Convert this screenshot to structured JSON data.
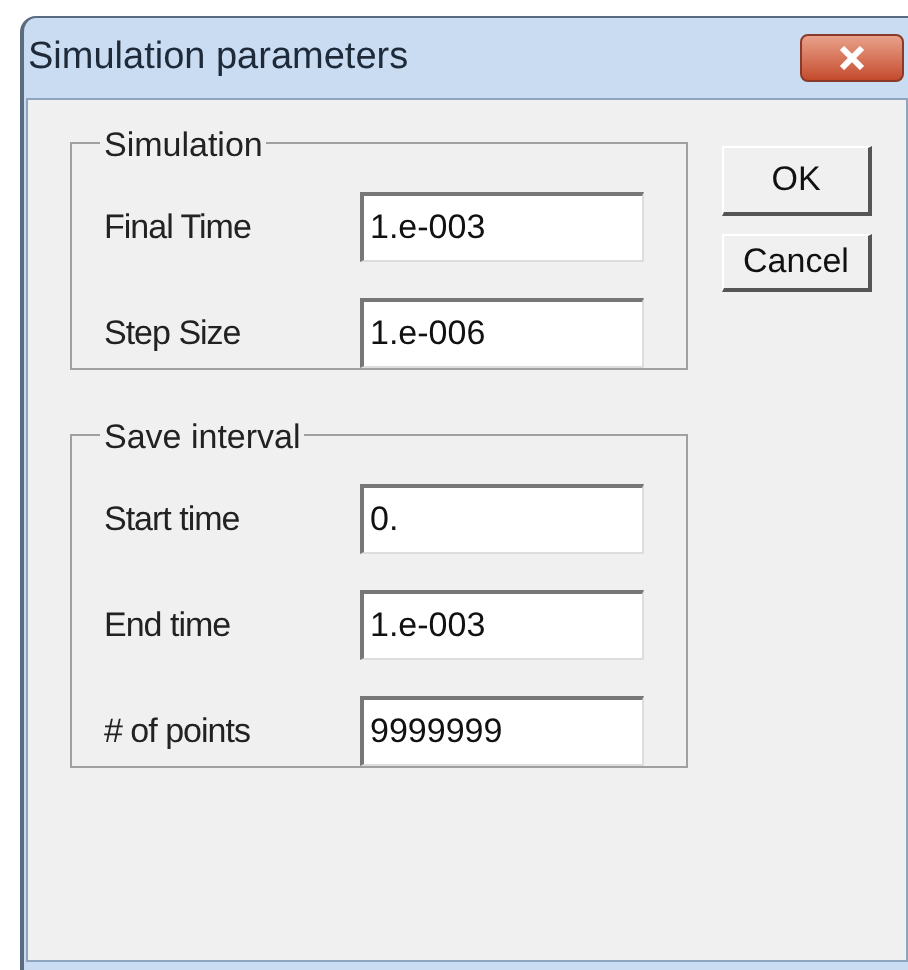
{
  "window": {
    "title": "Simulation parameters"
  },
  "groups": [
    {
      "title": "Simulation",
      "fields": [
        {
          "label": "Final Time",
          "value": "1.e-003"
        },
        {
          "label": "Step Size",
          "value": "1.e-006"
        }
      ]
    },
    {
      "title": "Save interval",
      "fields": [
        {
          "label": "Start time",
          "value": "0."
        },
        {
          "label": "End time",
          "value": "1.e-003"
        },
        {
          "label": "# of points",
          "value": "9999999"
        }
      ]
    }
  ],
  "buttons": [
    "OK",
    "Cancel"
  ]
}
